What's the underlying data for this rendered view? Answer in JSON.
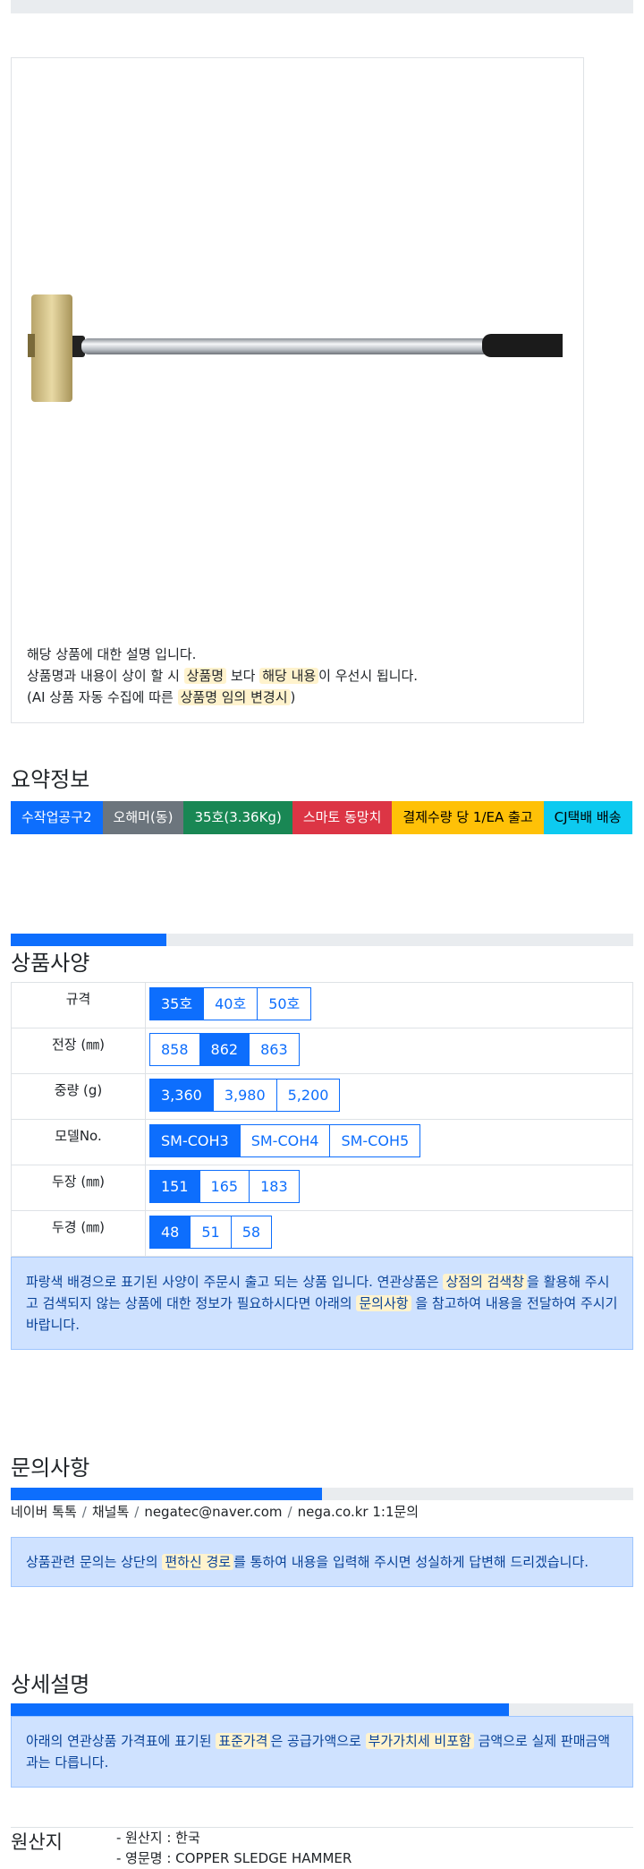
{
  "product": {
    "desc_line1": "해당 상품에 대한 설명 입니다.",
    "desc_line2_a": "상품명과 내용이 상이 할 시 ",
    "desc_line2_hl1": "상품명",
    "desc_line2_b": " 보다 ",
    "desc_line2_hl2": "해당 내용",
    "desc_line2_c": "이 우선시 됩니다.",
    "desc_line3_a": "(AI 상품 자동 수집에 따른 ",
    "desc_line3_hl": "상품명 임의 변경시",
    "desc_line3_b": ")"
  },
  "summary": {
    "title": "요약정보",
    "badges": [
      "수작업공구2",
      "오해머(동)",
      "35호(3.36Kg)",
      "스마토 동망치",
      "결제수량 당 1/EA 출고",
      "CJ택배 배송"
    ]
  },
  "spec": {
    "title": "상품사양",
    "progress_percent": 25,
    "rows": [
      {
        "label": "규격",
        "options": [
          "35호",
          "40호",
          "50호"
        ],
        "selected": 0
      },
      {
        "label": "전장 (㎜)",
        "options": [
          "858",
          "862",
          "863"
        ],
        "selected": 1
      },
      {
        "label": "중량 (g)",
        "options": [
          "3,360",
          "3,980",
          "5,200"
        ],
        "selected": 0
      },
      {
        "label": "모델No.",
        "options": [
          "SM-COH3",
          "SM-COH4",
          "SM-COH5"
        ],
        "selected": 0
      },
      {
        "label": "두장 (㎜)",
        "options": [
          "151",
          "165",
          "183"
        ],
        "selected": 0
      },
      {
        "label": "두경 (㎜)",
        "options": [
          "48",
          "51",
          "58"
        ],
        "selected": 0
      }
    ],
    "notice_a": "파랑색 배경으로 표기된 사양이 주문시 출고 되는 상품 입니다. 연관상품은 ",
    "notice_hl1": "상점의 검색창",
    "notice_b": "을 활용해 주시고 검색되지 않는 상품에 대한 정보가 필요하시다면 아래의 ",
    "notice_hl2": "문의사항",
    "notice_c": " 을 참고하여 내용을 전달하여 주시기 바랍니다."
  },
  "inquiry": {
    "title": "문의사항",
    "progress_percent": 50,
    "contacts": [
      "네이버 톡톡",
      "채널톡",
      "negatec@naver.com",
      "nega.co.kr 1:1문의"
    ],
    "notice_a": "상품관련 문의는 상단의 ",
    "notice_hl": "편하신 경로",
    "notice_b": "를 통하여 내용을 입력해 주시면 성실하게 답변해 드리겠습니다."
  },
  "detail": {
    "title": "상세설명",
    "progress_percent": 80,
    "notice_a": "아래의 연관상품 가격표에 표기된 ",
    "notice_hl1": "표준가격",
    "notice_b": "은 공급가액으로 ",
    "notice_hl2": "부가가치세 비포함",
    "notice_c": " 금액으로 실제 판매금액과는 다릅니다."
  },
  "origin": {
    "label": "원산지",
    "line1": "- 원산지 : 한국",
    "line2": "- 영문명 : COPPER SLEDGE HAMMER"
  },
  "colors": {
    "primary": "#0d6efd",
    "secondary": "#6c757d",
    "success": "#198754",
    "danger": "#dc3545",
    "warning": "#ffc107",
    "info": "#0dcaf0",
    "highlight": "#fff3cd",
    "alert_bg": "#cfe2ff"
  }
}
